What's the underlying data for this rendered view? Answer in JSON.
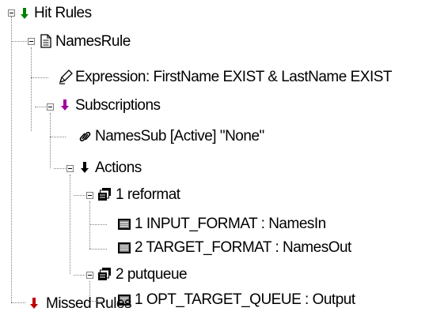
{
  "tree": {
    "hit_rules": {
      "label": "Hit Rules",
      "icon": "green-arrow-icon"
    },
    "names_rule": {
      "label": "NamesRule",
      "icon": "document-icon"
    },
    "expression": {
      "label": "Expression: FirstName EXIST  & LastName EXIST",
      "icon": "pen-icon"
    },
    "subscriptions": {
      "label": "Subscriptions",
      "icon": "purple-arrow-icon"
    },
    "names_sub": {
      "label": "NamesSub  [Active] \"None\"",
      "icon": "link-icon"
    },
    "actions": {
      "label": "Actions",
      "icon": "black-arrow-icon"
    },
    "reformat": {
      "label": "1 reformat",
      "icon": "stack-icon"
    },
    "input_format": {
      "label": "1 INPUT_FORMAT : NamesIn",
      "icon": "field-icon"
    },
    "target_format": {
      "label": "2 TARGET_FORMAT : NamesOut",
      "icon": "field-icon"
    },
    "putqueue": {
      "label": "2 putqueue",
      "icon": "stack-icon"
    },
    "opt_target_queue": {
      "label": "1 OPT_TARGET_QUEUE : Output",
      "icon": "field-icon"
    },
    "missed_rules": {
      "label": "Missed Rules",
      "icon": "red-arrow-icon"
    }
  },
  "colors": {
    "hit_arrow": "#008000",
    "subscriptions_arrow": "#a000a0",
    "actions_arrow": "#000000",
    "missed_arrow": "#c00000"
  }
}
